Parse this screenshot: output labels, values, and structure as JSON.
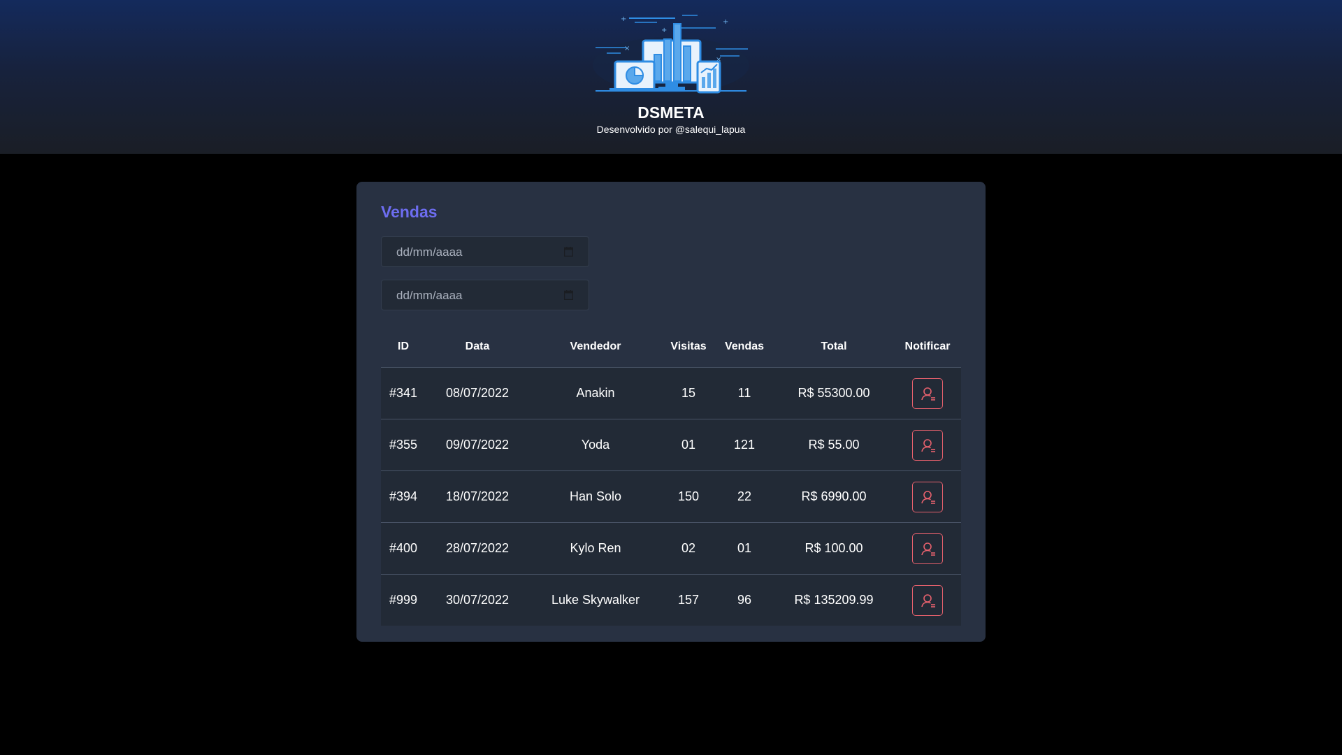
{
  "header": {
    "title": "DSMETA",
    "subtitle": "Desenvolvido por @salequi_lapua",
    "logo_icon": "analytics-dashboard-illustration-icon"
  },
  "card": {
    "title": "Vendas",
    "date_min": {
      "placeholder": "dd/mm/aaaa",
      "icon": "calendar-icon"
    },
    "date_max": {
      "placeholder": "dd/mm/aaaa",
      "icon": "calendar-icon"
    }
  },
  "table": {
    "columns": [
      "ID",
      "Data",
      "Vendedor",
      "Visitas",
      "Vendas",
      "Total",
      "Notificar"
    ],
    "rows": [
      {
        "id": "#341",
        "date": "08/07/2022",
        "seller": "Anakin",
        "visits": "15",
        "sales": "11",
        "total": "R$ 55300.00"
      },
      {
        "id": "#355",
        "date": "09/07/2022",
        "seller": "Yoda",
        "visits": "01",
        "sales": "121",
        "total": "R$ 55.00"
      },
      {
        "id": "#394",
        "date": "18/07/2022",
        "seller": "Han Solo",
        "visits": "150",
        "sales": "22",
        "total": "R$ 6990.00"
      },
      {
        "id": "#400",
        "date": "28/07/2022",
        "seller": "Kylo Ren",
        "visits": "02",
        "sales": "01",
        "total": "R$ 100.00"
      },
      {
        "id": "#999",
        "date": "30/07/2022",
        "seller": "Luke Skywalker",
        "visits": "157",
        "sales": "96",
        "total": "R$ 135209.99"
      }
    ],
    "notify_icon": "user-notify-icon"
  },
  "colors": {
    "accent": "#6d6df0",
    "notify": "#e7616d",
    "card_bg": "#283142",
    "row_bg": "#222a36"
  }
}
